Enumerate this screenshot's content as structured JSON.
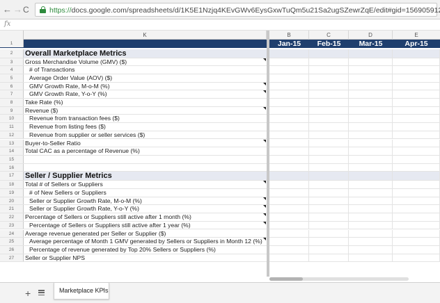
{
  "browser": {
    "url_scheme": "https://",
    "url_rest": "docs.google.com/spreadsheets/d/1K5E1Nzjq4KEvGWv6EysGxwTuQm5u21Sa2ugSZewrZqE/edit#gid=1569059121",
    "back_glyph": "←",
    "forward_glyph": "→",
    "reload_glyph": "C"
  },
  "formula_bar": {
    "fx_label": "fx"
  },
  "columns": {
    "k": "K",
    "b": "B",
    "c": "C",
    "d": "D",
    "e": "E"
  },
  "header_row": {
    "row_number": "1",
    "months": [
      "Jan-15",
      "Feb-15",
      "Mar-15",
      "Apr-15"
    ]
  },
  "rows": [
    {
      "num": "2",
      "label": "Overall Marketplace Metrics",
      "kind": "section",
      "note": false
    },
    {
      "num": "3",
      "label": "Gross Merchandise Volume (GMV) ($)",
      "kind": "item",
      "note": true
    },
    {
      "num": "4",
      "label": "# of Transactions",
      "kind": "sub",
      "note": false
    },
    {
      "num": "5",
      "label": "Average Order Value (AOV) ($)",
      "kind": "sub",
      "note": false
    },
    {
      "num": "6",
      "label": "GMV Growth Rate, M-o-M (%)",
      "kind": "sub",
      "note": true
    },
    {
      "num": "7",
      "label": "GMV Growth Rate, Y-o-Y (%)",
      "kind": "sub",
      "note": true
    },
    {
      "num": "8",
      "label": "Take Rate (%)",
      "kind": "item",
      "note": false
    },
    {
      "num": "9",
      "label": "Revenue ($)",
      "kind": "item",
      "note": true
    },
    {
      "num": "10",
      "label": "Revenue from transaction fees ($)",
      "kind": "sub",
      "note": false
    },
    {
      "num": "11",
      "label": "Revenue from listing fees ($)",
      "kind": "sub",
      "note": false
    },
    {
      "num": "12",
      "label": "Revenue from supplier or seller services ($)",
      "kind": "sub",
      "note": false
    },
    {
      "num": "13",
      "label": "Buyer-to-Seller Ratio",
      "kind": "item",
      "note": true
    },
    {
      "num": "14",
      "label": "Total CAC as a percentage of Revenue (%)",
      "kind": "item",
      "note": false
    },
    {
      "num": "15",
      "label": "",
      "kind": "item",
      "note": false
    },
    {
      "num": "16",
      "label": "",
      "kind": "item",
      "note": false
    },
    {
      "num": "17",
      "label": "Seller / Supplier Metrics",
      "kind": "section",
      "note": false
    },
    {
      "num": "18",
      "label": "Total # of Sellers or Suppliers",
      "kind": "item",
      "note": true
    },
    {
      "num": "19",
      "label": "# of New Sellers or Suppliers",
      "kind": "sub",
      "note": false
    },
    {
      "num": "20",
      "label": "Seller or Supplier Growth Rate, M-o-M (%)",
      "kind": "sub",
      "note": true
    },
    {
      "num": "21",
      "label": "Seller or Supplier Growth Rate, Y-o-Y (%)",
      "kind": "sub",
      "note": true
    },
    {
      "num": "22",
      "label": "Percentage of Sellers or Suppliers still active after 1 month (%)",
      "kind": "item",
      "note": true
    },
    {
      "num": "23",
      "label": "Percentage of Sellers or Suppliers still active after 1 year (%)",
      "kind": "sub",
      "note": true
    },
    {
      "num": "24",
      "label": "Average revenue generated per Seller or Supplier ($)",
      "kind": "item",
      "note": false
    },
    {
      "num": "25",
      "label": "Average percentage of Month 1 GMV generated by Sellers or Suppliers in Month 12 (%)",
      "kind": "sub",
      "note": true
    },
    {
      "num": "26",
      "label": "Percentage of revenue generated by Top 20% Sellers or Suppliers (%)",
      "kind": "sub",
      "note": false
    },
    {
      "num": "27",
      "label": "Seller or Supplier NPS",
      "kind": "item",
      "note": false
    }
  ],
  "sheet_bar": {
    "add_glyph": "+",
    "tab_label": "Marketplace KPIs",
    "tab_caret": "▾"
  }
}
